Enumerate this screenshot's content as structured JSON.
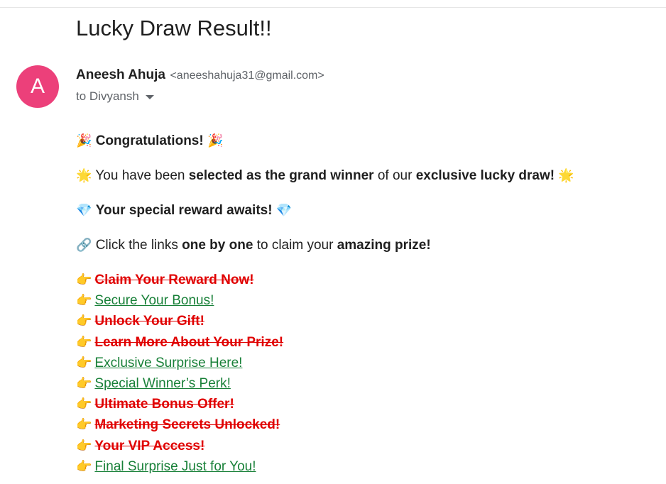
{
  "email": {
    "subject": "Lucky Draw Result!!",
    "avatar_letter": "A",
    "sender_name": "Aneesh Ahuja",
    "sender_email": "<aneeshahuja31@gmail.com>",
    "recipient": "to Divyansh"
  },
  "content": {
    "p1": {
      "emoji": "🎉",
      "bold": "Congratulations!",
      "emoji_end": "🎉"
    },
    "p2": {
      "emoji": "🌟",
      "t1": "You have been ",
      "b1": "selected as the grand winner",
      "t2": " of our ",
      "b2": "exclusive lucky draw!",
      "emoji_end": "🌟"
    },
    "p3": {
      "emoji": "💎",
      "bold": "Your special reward awaits!",
      "emoji_end": "💎"
    },
    "p4": {
      "emoji": "🔗",
      "t1": "Click the links ",
      "b1": "one by one",
      "t2": " to claim your ",
      "b2": "amazing prize!"
    }
  },
  "links": [
    {
      "label": "Claim Your Reward Now!",
      "state": "struck"
    },
    {
      "label": "Secure Your Bonus!",
      "state": "active"
    },
    {
      "label": "Unlock Your Gift!",
      "state": "struck"
    },
    {
      "label": "Learn More About Your Prize!",
      "state": "struck"
    },
    {
      "label": "Exclusive Surprise Here!",
      "state": "active"
    },
    {
      "label": "Special Winner’s Perk!",
      "state": "active"
    },
    {
      "label": "Ultimate Bonus Offer!",
      "state": "struck"
    },
    {
      "label": "Marketing Secrets Unlocked!",
      "state": "struck"
    },
    {
      "label": "Your VIP Access!",
      "state": "struck"
    },
    {
      "label": "Final Surprise Just for You!",
      "state": "active"
    }
  ],
  "link_icon": "👉",
  "colors": {
    "avatar": "#ec407a",
    "active_link": "#188038",
    "struck_link": "#e00000"
  }
}
